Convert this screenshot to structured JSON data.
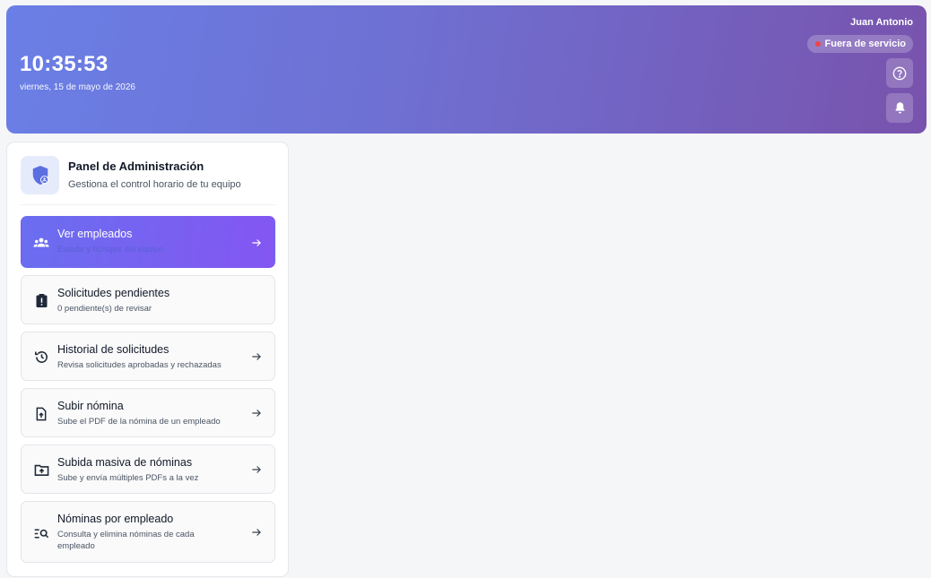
{
  "header": {
    "time": "10:35:53",
    "date": "viernes, 15 de mayo de 2026",
    "user_name": "Juan Antonio",
    "status": "Fuera de servicio",
    "icons": {
      "help": "help-circle-icon",
      "notifications": "bell-icon"
    }
  },
  "panel": {
    "title": "Panel de Administración",
    "subtitle": "Gestiona el control horario de tu equipo",
    "icon": "shield-user-icon",
    "items": [
      {
        "title": "Ver empleados",
        "desc": "Estado y fichajes del equipo",
        "icon": "users-icon"
      },
      {
        "title": "Solicitudes pendientes",
        "desc": "0 pendiente(s) de revisar",
        "icon": "clipboard-alert-icon"
      },
      {
        "title": "Historial de solicitudes",
        "desc": "Revisa solicitudes aprobadas y rechazadas",
        "icon": "history-icon"
      },
      {
        "title": "Subir nómina",
        "desc": "Sube el PDF de la nómina de un empleado",
        "icon": "file-upload-icon"
      },
      {
        "title": "Subida masiva de nóminas",
        "desc": "Sube y envía múltiples PDFs a la vez",
        "icon": "folder-upload-icon"
      },
      {
        "title": "Nóminas por empleado",
        "desc": "Consulta y elimina nóminas de cada empleado",
        "icon": "list-search-icon"
      }
    ]
  },
  "colors": {
    "header_gradient_start": "#6a7fe6",
    "header_gradient_end": "#7853ad",
    "active_item_start": "#6a6ef0",
    "active_item_end": "#8456f2",
    "status_dot": "#ef4444"
  }
}
